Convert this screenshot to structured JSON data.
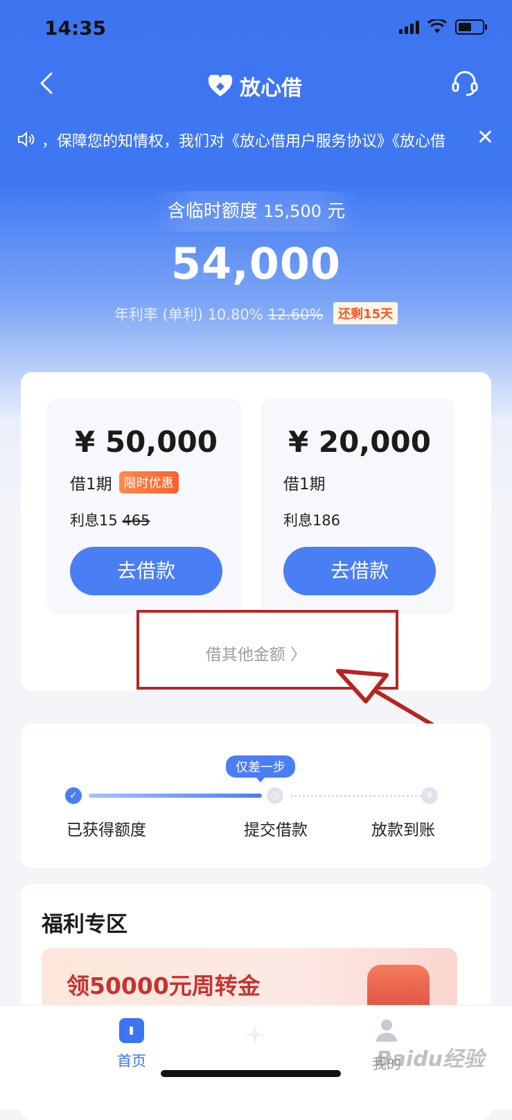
{
  "status_bar": {
    "time": "14:35"
  },
  "header": {
    "title": "放心借"
  },
  "notice": {
    "text": "，保障您的知情权，我们对《放心借用户服务协议》《放心借",
    "close": "✕"
  },
  "credit": {
    "temporary_prefix": "含临时额度",
    "temporary_amount": "15,500",
    "temporary_unit": "元",
    "limit": "54,000",
    "rate_label": "年利率 (单利) 10.80%",
    "old_rate": "12.60%",
    "remaining_badge": "还剩15天"
  },
  "loan_options": [
    {
      "amount": "¥ 50,000",
      "term": "借1期",
      "tag": "限时优惠",
      "interest_prefix": "利息15",
      "interest_struck": "465",
      "button": "去借款"
    },
    {
      "amount": "¥ 20,000",
      "term": "借1期",
      "tag": "",
      "interest_prefix": "利息186",
      "interest_struck": "",
      "button": "去借款"
    }
  ],
  "other_amount": "借其他金额 〉",
  "progress": {
    "pill": "仅差一步",
    "steps": [
      "已获得额度",
      "提交借款",
      "放款到账"
    ],
    "step_icons": [
      "✓",
      "◷",
      "¥"
    ]
  },
  "welfare": {
    "title": "福利专区",
    "banner_text": "领50000元周转金"
  },
  "tabbar": {
    "home": "首页",
    "me": "我的"
  },
  "watermark": "Baidu经验",
  "colors": {
    "primary": "#3d74f0",
    "button": "#4a7ef5",
    "annotation_red": "#b52522",
    "badge_orange": "#f25a23"
  }
}
